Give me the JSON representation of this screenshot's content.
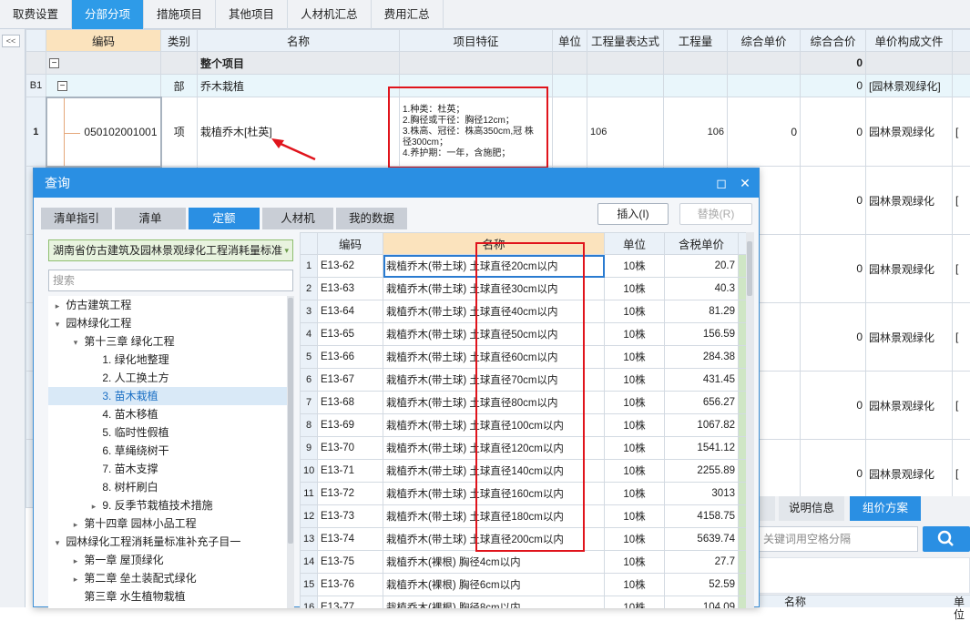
{
  "top_tabs": [
    "取费设置",
    "分部分项",
    "措施项目",
    "其他项目",
    "人材机汇总",
    "费用汇总"
  ],
  "top_tabs_active": 1,
  "sidebar": {
    "collapse_label": "<<"
  },
  "main": {
    "columns": [
      "",
      "编码",
      "类别",
      "名称",
      "项目特征",
      "单位",
      "工程量表达式",
      "工程量",
      "综合单价",
      "综合合价",
      "单价构成文件"
    ],
    "whole": {
      "label": "整个项目",
      "total": "0"
    },
    "b1": {
      "rnum": "B1",
      "type": "部",
      "name": "乔木栽植",
      "total": "0",
      "file": "[园林景观绿化]"
    },
    "item1": {
      "rnum": "1",
      "code": "050102001001",
      "type": "项",
      "name": "栽植乔木[杜英]",
      "features": [
        "1.种类：杜英；",
        "2.胸径或干径：胸径12cm；",
        "3.株高、冠径：株高350cm,冠 株",
        "径300cm；",
        "4.养护期：一年，含施肥；"
      ],
      "expr": "106",
      "qty": "106",
      "price": "0",
      "total": "0",
      "file": "园林景观绿化"
    },
    "rows": [
      {
        "total": "0",
        "file": "园林景观绿化"
      },
      {
        "total": "0",
        "file": "园林景观绿化"
      },
      {
        "total": "0",
        "file": "园林景观绿化"
      },
      {
        "total": "0",
        "file": "园林景观绿化"
      },
      {
        "total": "0",
        "file": "园林景观绿化"
      },
      {
        "total": "0",
        "file": "园林景观绿化"
      }
    ]
  },
  "dialog": {
    "title": "查询",
    "tabs": [
      "清单指引",
      "清单",
      "定额",
      "人材机",
      "我的数据"
    ],
    "tabs_active": 2,
    "insert_label": "插入(I)",
    "replace_label": "替换(R)",
    "library": "湖南省仿古建筑及园林景观绿化工程消耗量标准",
    "search_placeholder": "搜索",
    "tree": [
      {
        "label": "仿古建筑工程",
        "level": 0,
        "arrow": "▸"
      },
      {
        "label": "园林绿化工程",
        "level": 0,
        "arrow": "▾"
      },
      {
        "label": "第十三章 绿化工程",
        "level": 1,
        "arrow": "▾"
      },
      {
        "label": "1. 绿化地整理",
        "level": 2,
        "arrow": ""
      },
      {
        "label": "2. 人工换土方",
        "level": 2,
        "arrow": ""
      },
      {
        "label": "3. 苗木栽植",
        "level": 2,
        "arrow": "",
        "selected": true
      },
      {
        "label": "4. 苗木移植",
        "level": 2,
        "arrow": ""
      },
      {
        "label": "5. 临时性假植",
        "level": 2,
        "arrow": ""
      },
      {
        "label": "6. 草绳绕树干",
        "level": 2,
        "arrow": ""
      },
      {
        "label": "7. 苗木支撑",
        "level": 2,
        "arrow": ""
      },
      {
        "label": "8. 树杆刷白",
        "level": 2,
        "arrow": ""
      },
      {
        "label": "9. 反季节栽植技术措施",
        "level": 2,
        "arrow": "▸"
      },
      {
        "label": "第十四章 园林小品工程",
        "level": 1,
        "arrow": "▸"
      },
      {
        "label": "园林绿化工程消耗量标准补充子目一",
        "level": 0,
        "arrow": "▾"
      },
      {
        "label": "第一章 屋顶绿化",
        "level": 1,
        "arrow": "▸"
      },
      {
        "label": "第二章 垒土装配式绿化",
        "level": 1,
        "arrow": "▸"
      },
      {
        "label": "第三章 水生植物栽植",
        "level": 1,
        "arrow": ""
      }
    ],
    "grid_headers": [
      "",
      "编码",
      "名称",
      "单位",
      "含税单价"
    ],
    "grid_rows": [
      {
        "n": "1",
        "code": "E13-62",
        "name": "栽植乔木(带土球) 土球直径20cm以内",
        "unit": "10株",
        "price": "20.7"
      },
      {
        "n": "2",
        "code": "E13-63",
        "name": "栽植乔木(带土球) 土球直径30cm以内",
        "unit": "10株",
        "price": "40.3"
      },
      {
        "n": "3",
        "code": "E13-64",
        "name": "栽植乔木(带土球) 土球直径40cm以内",
        "unit": "10株",
        "price": "81.29"
      },
      {
        "n": "4",
        "code": "E13-65",
        "name": "栽植乔木(带土球) 土球直径50cm以内",
        "unit": "10株",
        "price": "156.59"
      },
      {
        "n": "5",
        "code": "E13-66",
        "name": "栽植乔木(带土球) 土球直径60cm以内",
        "unit": "10株",
        "price": "284.38"
      },
      {
        "n": "6",
        "code": "E13-67",
        "name": "栽植乔木(带土球) 土球直径70cm以内",
        "unit": "10株",
        "price": "431.45"
      },
      {
        "n": "7",
        "code": "E13-68",
        "name": "栽植乔木(带土球) 土球直径80cm以内",
        "unit": "10株",
        "price": "656.27"
      },
      {
        "n": "8",
        "code": "E13-69",
        "name": "栽植乔木(带土球) 土球直径100cm以内",
        "unit": "10株",
        "price": "1067.82"
      },
      {
        "n": "9",
        "code": "E13-70",
        "name": "栽植乔木(带土球) 土球直径120cm以内",
        "unit": "10株",
        "price": "1541.12"
      },
      {
        "n": "10",
        "code": "E13-71",
        "name": "栽植乔木(带土球) 土球直径140cm以内",
        "unit": "10株",
        "price": "2255.89"
      },
      {
        "n": "11",
        "code": "E13-72",
        "name": "栽植乔木(带土球) 土球直径160cm以内",
        "unit": "10株",
        "price": "3013"
      },
      {
        "n": "12",
        "code": "E13-73",
        "name": "栽植乔木(带土球) 土球直径180cm以内",
        "unit": "10株",
        "price": "4158.75"
      },
      {
        "n": "13",
        "code": "E13-74",
        "name": "栽植乔木(带土球) 土球直径200cm以内",
        "unit": "10株",
        "price": "5639.74"
      },
      {
        "n": "14",
        "code": "E13-75",
        "name": "栽植乔木(裸根) 胸径4cm以内",
        "unit": "10株",
        "price": "27.7"
      },
      {
        "n": "15",
        "code": "E13-76",
        "name": "栽植乔木(裸根) 胸径6cm以内",
        "unit": "10株",
        "price": "52.59"
      },
      {
        "n": "16",
        "code": "E13-77",
        "name": "栽植乔木(裸根) 胸径8cm以内",
        "unit": "10株",
        "price": "104.09"
      }
    ]
  },
  "bottom_panel": {
    "tabs": [
      "说明信息",
      "组价方案"
    ],
    "search_placeholder": "关键词用空格分隔",
    "col": "名称",
    "col2": "单位"
  },
  "colors": {
    "accent": "#2a8fe3",
    "highlight": "#e0141c"
  }
}
